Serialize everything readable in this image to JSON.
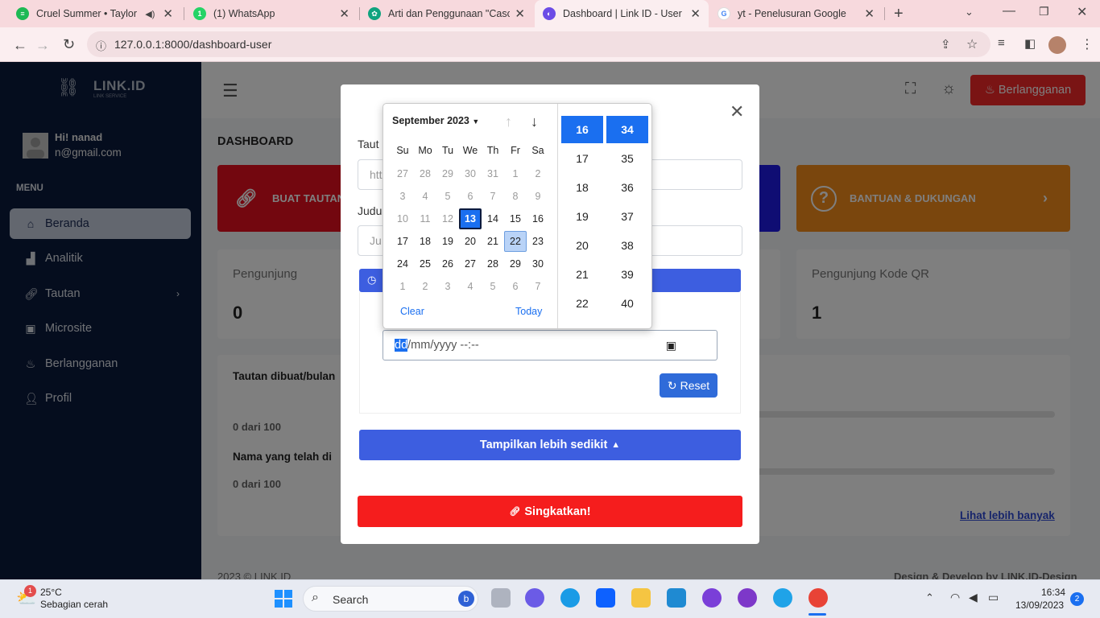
{
  "browser": {
    "tabs": [
      {
        "title": "Cruel Summer • Taylor Sw",
        "color": "#1db954"
      },
      {
        "title": "(1) WhatsApp",
        "color": "#25d366"
      },
      {
        "title": "Arti dan Penggunaan \"Cascad",
        "color": "#10a37f"
      },
      {
        "title": "Dashboard | Link ID - User",
        "color": "#6b4ce6"
      },
      {
        "title": "yt - Penelusuran Google",
        "color": "#4285f4"
      }
    ],
    "url": "127.0.0.1:8000/dashboard-user"
  },
  "sidebar": {
    "logo": "LINK.ID",
    "logo_sub": "LINK SERVICE",
    "greeting": "Hi! nanad",
    "email": "n@gmail.com",
    "menu_label": "MENU",
    "items": [
      {
        "label": "Beranda",
        "icon": "home-icon"
      },
      {
        "label": "Analitik",
        "icon": "bar-chart-icon"
      },
      {
        "label": "Tautan",
        "icon": "link-icon"
      },
      {
        "label": "Microsite",
        "icon": "id-card-icon"
      },
      {
        "label": "Berlangganan",
        "icon": "fire-icon"
      },
      {
        "label": "Profil",
        "icon": "user-icon"
      }
    ]
  },
  "topnav": {
    "subscribe_label": "Berlangganan"
  },
  "page": {
    "title": "DASHBOARD",
    "hero_left": "BUAT TAUTAN",
    "hero_right": "BANTUAN & DUKUNGAN",
    "stat_left_label": "Pengunjung",
    "stat_left_value": "0",
    "stat_right_label": "Pengunjung Kode QR",
    "stat_right_value": "1",
    "chart_title": "Tautan dibuat/bulan",
    "progress1": "0 dari 100",
    "names_title": "Nama yang telah di",
    "progress2": "0 dari 100",
    "more_link": "Lihat lebih banyak",
    "footer_left": "2023 © LINK.ID",
    "footer_right": "Design & Develop by LINK.ID-Design"
  },
  "modal": {
    "label_url": "Taut",
    "placeholder_url": "htt",
    "label_title": "Judu",
    "placeholder_title": "Ju",
    "datetime_sel": "dd",
    "datetime_rest": "/mm/yyyy --:--",
    "reset_label": "Reset",
    "less_label": "Tampilkan lebih sedikit",
    "shorten_label": "Singkatkan!"
  },
  "picker": {
    "month": "September 2023",
    "dow": [
      "Su",
      "Mo",
      "Tu",
      "We",
      "Th",
      "Fr",
      "Sa"
    ],
    "weeks": [
      [
        "27",
        "28",
        "29",
        "30",
        "31",
        "1",
        "2"
      ],
      [
        "3",
        "4",
        "5",
        "6",
        "7",
        "8",
        "9"
      ],
      [
        "10",
        "11",
        "12",
        "13",
        "14",
        "15",
        "16"
      ],
      [
        "17",
        "18",
        "19",
        "20",
        "21",
        "22",
        "23"
      ],
      [
        "24",
        "25",
        "26",
        "27",
        "28",
        "29",
        "30"
      ],
      [
        "1",
        "2",
        "3",
        "4",
        "5",
        "6",
        "7"
      ]
    ],
    "selected_day": "13",
    "highlight_day": "22",
    "clear_label": "Clear",
    "today_label": "Today",
    "hours": [
      "16",
      "17",
      "18",
      "19",
      "20",
      "21",
      "22"
    ],
    "minutes": [
      "34",
      "35",
      "36",
      "37",
      "38",
      "39",
      "40"
    ]
  },
  "taskbar": {
    "weather_temp": "25°C",
    "weather_desc": "Sebagian cerah",
    "search_label": "Search",
    "time": "16:34",
    "date": "13/09/2023",
    "notif_count": "2",
    "weather_badge": "1"
  }
}
